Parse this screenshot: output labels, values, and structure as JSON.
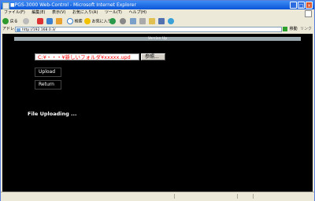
{
  "window": {
    "title": "■PGS-3000 Web-Control - Microsoft Internet Explorer"
  },
  "menu": [
    "ファイル(F)",
    "編集(E)",
    "表示(V)",
    "お気に入り(A)",
    "ツール(T)",
    "ヘルプ(H)"
  ],
  "toolbar": {
    "back_label": "戻る",
    "search_label": "検索",
    "favorites_label": "お気に入り"
  },
  "address": {
    "label": "アドレス(D)",
    "url": "http://192.168.0.3/",
    "go_label": "移動",
    "links_label": "リンク"
  },
  "page": {
    "section_title": "Version Up",
    "file_path": "C:¥・・・¥新しいフォルダ¥xxxxx.upd",
    "browse_label": "参照...",
    "upload_label": "Upload",
    "return_label": "Return",
    "status_text": "File Uploading ..."
  },
  "colors": {
    "title_bar": "#0a56d8",
    "page_bg": "#000000",
    "section_bar": "#9aa8b0",
    "file_path_text": "#ff0000"
  }
}
